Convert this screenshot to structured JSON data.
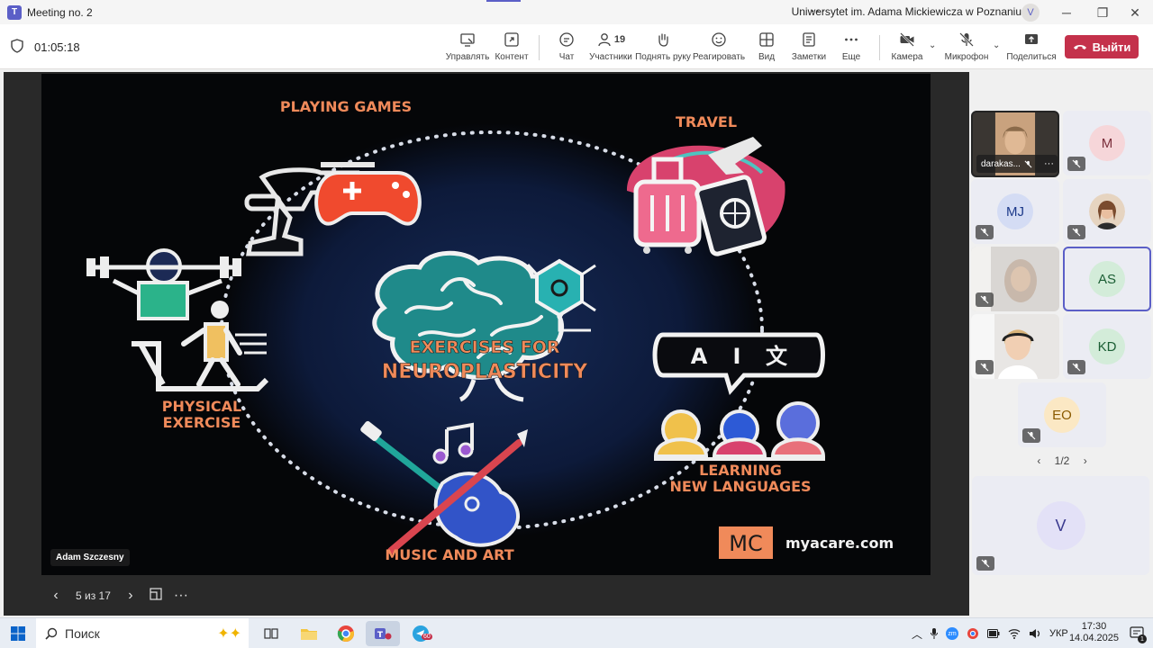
{
  "window": {
    "title": "Meeting no. 2",
    "org": "Uniwersytet im. Adama Mickiewicza w Poznaniu",
    "user_initial": "V",
    "more": "···",
    "minimize": "─",
    "restore": "❐",
    "close": "✕"
  },
  "toolbar": {
    "timer": "01:05:18",
    "manage": "Управлять",
    "content": "Контент",
    "chat": "Чат",
    "participants": "Участники",
    "participants_count": "19",
    "raise_hand": "Поднять руку",
    "react": "Реагировать",
    "view": "Вид",
    "notes": "Заметки",
    "more": "Еще",
    "camera": "Камера",
    "mic": "Микрофон",
    "share": "Поделиться",
    "leave": "Выйти"
  },
  "slide": {
    "t_games": "PLAYING GAMES",
    "t_travel": "TRAVEL",
    "t_physical_1": "PHYSICAL",
    "t_physical_2": "EXERCISE",
    "t_center_1": "EXERCISES FOR",
    "t_center_2": "NEUROPLASTICITY",
    "t_languages_1": "LEARNING",
    "t_languages_2": "NEW LANGUAGES",
    "t_music": "MUSIC AND ART",
    "logo_mc": "MC",
    "logo_url": "myacare.com",
    "lang_a": "A",
    "lang_i": "I",
    "lang_wen": "文"
  },
  "presenter": "Adam Szczesny",
  "slide_nav": {
    "pages": "5 из 17"
  },
  "gallery": {
    "self_name": "darakas...",
    "tiles": [
      "M",
      "MJ",
      "AS",
      "KD",
      "EO",
      "V"
    ],
    "pager": "1/2"
  },
  "taskbar": {
    "search": "Поиск",
    "lang": "УКР",
    "time": "17:30",
    "date": "14.04.2025",
    "notif_count": "1",
    "telegram_badge": "60"
  },
  "colors": {
    "accent": "#5b5fc7",
    "leave": "#c4314b",
    "slide_orange": "#f08a5a"
  }
}
